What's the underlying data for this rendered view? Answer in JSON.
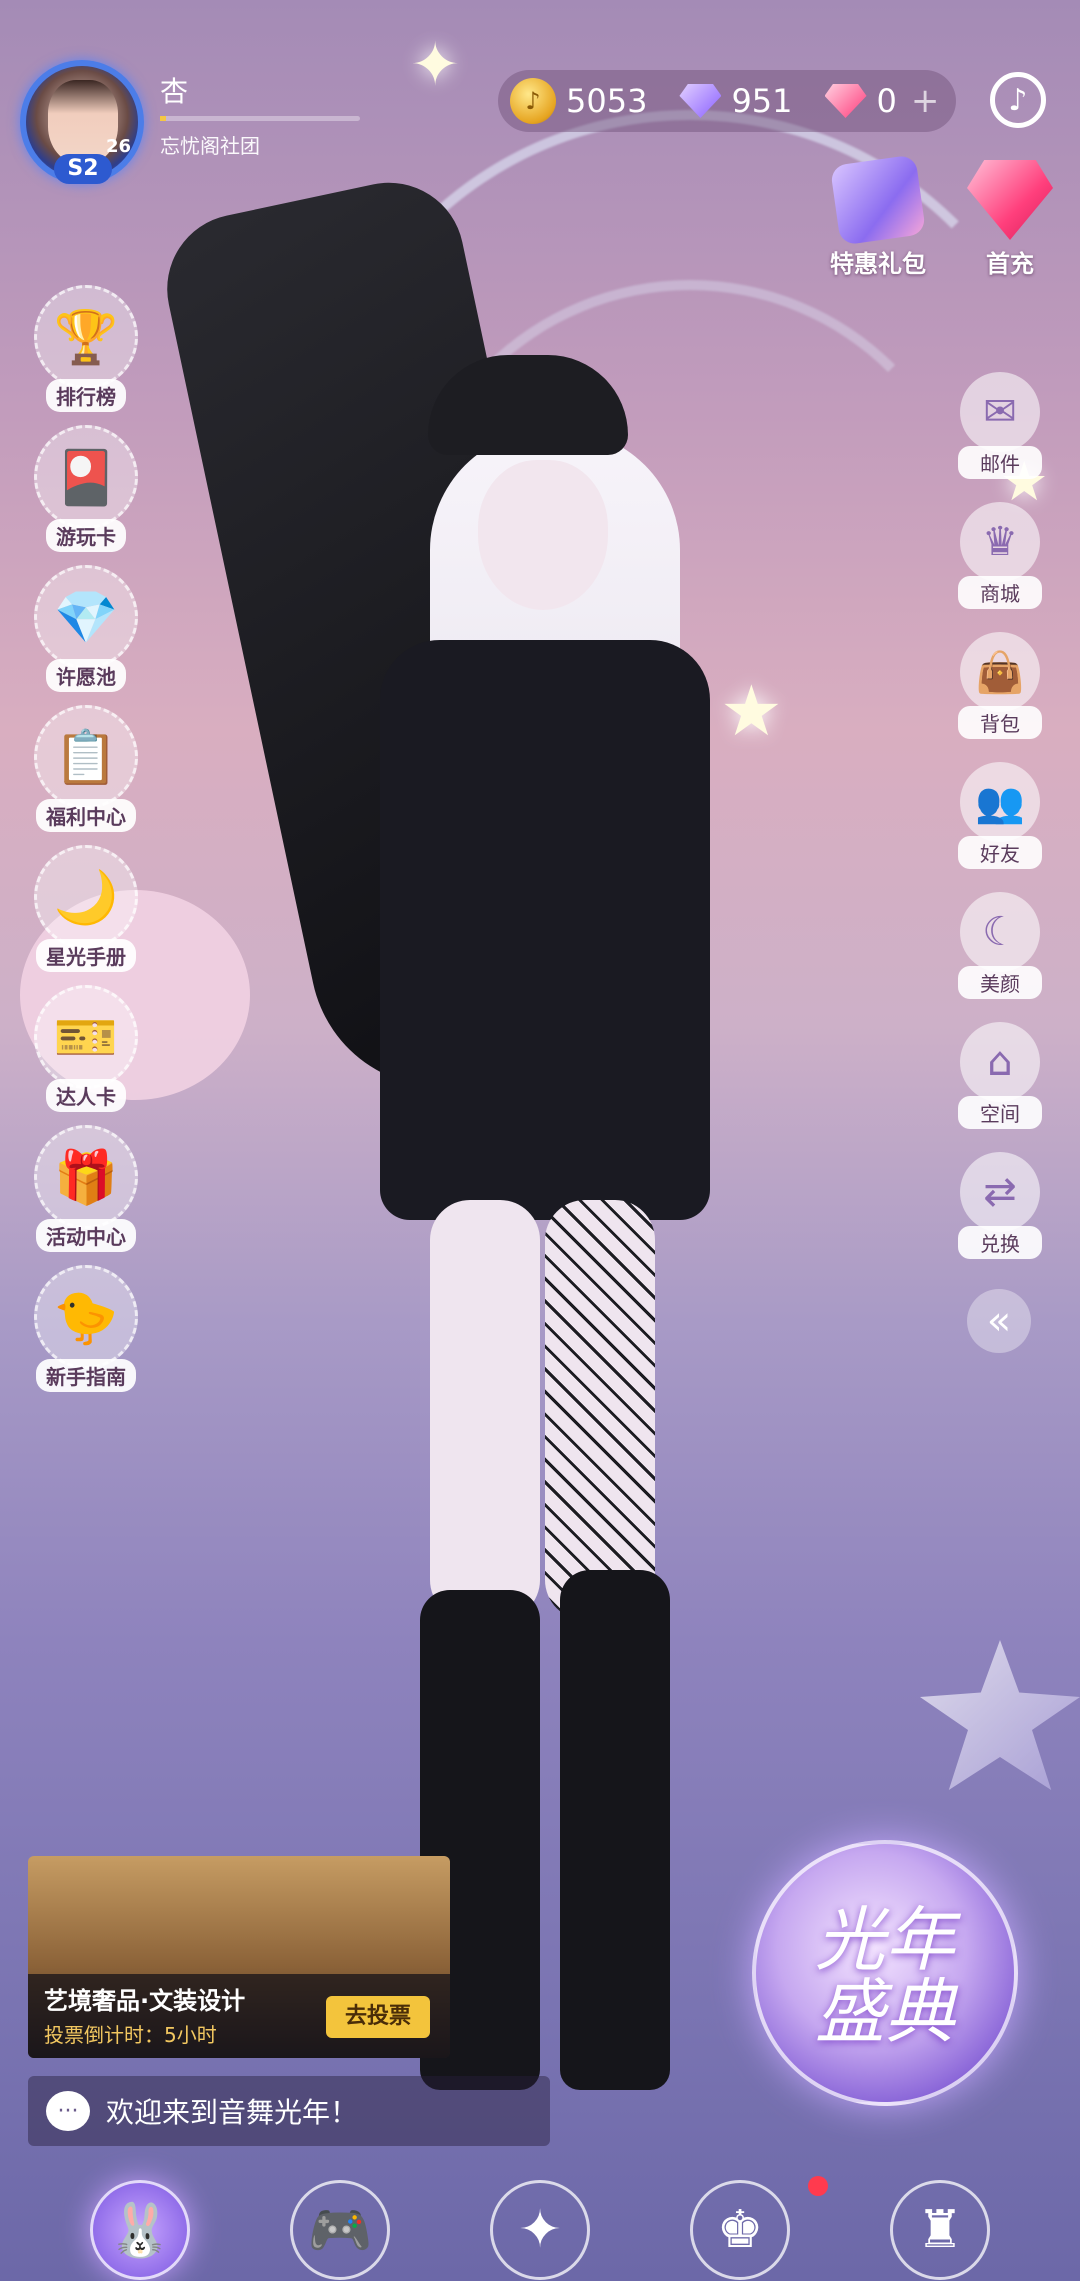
{
  "profile": {
    "nickname": "杏",
    "club": "忘忧阁社团",
    "season_badge": "S2",
    "level": "26"
  },
  "currency": {
    "coins": "5053",
    "diamonds": "951",
    "pink_diamonds": "0",
    "add_symbol": "+"
  },
  "top_actions": {
    "gift_pack": "特惠礼包",
    "first_recharge": "首充"
  },
  "left_menu": [
    {
      "label": "排行榜",
      "icon": "trophy-icon"
    },
    {
      "label": "游玩卡",
      "icon": "card-icon"
    },
    {
      "label": "许愿池",
      "icon": "crystal-icon"
    },
    {
      "label": "福利中心",
      "icon": "checklist-icon"
    },
    {
      "label": "星光手册",
      "icon": "moon-icon"
    },
    {
      "label": "达人卡",
      "icon": "ticket-icon"
    },
    {
      "label": "活动中心",
      "icon": "giftbox-icon"
    },
    {
      "label": "新手指南",
      "icon": "chick-icon"
    }
  ],
  "right_menu": [
    {
      "label": "邮件",
      "icon": "mail-icon"
    },
    {
      "label": "商城",
      "icon": "crown-shop-icon"
    },
    {
      "label": "背包",
      "icon": "bag-icon"
    },
    {
      "label": "好友",
      "icon": "friends-icon"
    },
    {
      "label": "美颜",
      "icon": "face-icon"
    },
    {
      "label": "空间",
      "icon": "house-icon"
    },
    {
      "label": "兑换",
      "icon": "exchange-icon"
    }
  ],
  "event": {
    "title": "艺境奢品·文装设计",
    "countdown": "投票倒计时：5小时",
    "vote_button": "去投票"
  },
  "chat": {
    "message": "欢迎来到音舞光年！"
  },
  "festival": {
    "line1": "光年",
    "line2": "盛典"
  },
  "bottom_nav": [
    {
      "icon": "rabbit-home-icon",
      "active": true
    },
    {
      "icon": "gamepad-icon",
      "active": false
    },
    {
      "icon": "compass-star-icon",
      "active": false
    },
    {
      "icon": "character-icon",
      "active": false,
      "badge": true
    },
    {
      "icon": "wardrobe-icon",
      "active": false
    }
  ]
}
